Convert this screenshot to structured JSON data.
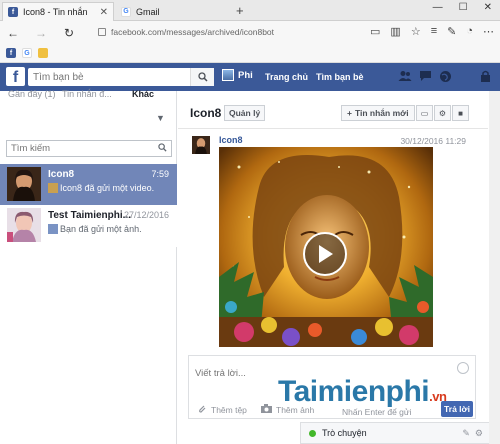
{
  "browser": {
    "tabs": [
      {
        "title": "Icon8 - Tin nhắn",
        "active": true
      },
      {
        "title": "Gmail",
        "active": false
      }
    ],
    "new_tab": "+",
    "window_buttons": [
      "—",
      "☐",
      "✕"
    ],
    "address": "facebook.com/messages/archived/icon8bot",
    "nav": {
      "back": "←",
      "forward": "→",
      "reload": "↻"
    }
  },
  "facebook": {
    "search_placeholder": "Tìm bạn bè",
    "profile_name": "Phi",
    "links": [
      "Trang chủ",
      "Tìm bạn bè"
    ],
    "brand_color": "#3b5998"
  },
  "sidebar": {
    "filters": [
      "Gần đây (1)",
      "Tin nhắn đ...",
      "Khác"
    ],
    "search_placeholder": "Tìm kiếm",
    "conversations": [
      {
        "name": "Icon8",
        "time": "7:59",
        "preview": "Icon8 đã gửi một video.",
        "selected": true
      },
      {
        "name": "Test Taimienphi...",
        "time": "27/12/2016",
        "preview": "Bạn đã gửi một ảnh.",
        "selected": false
      }
    ],
    "selected_color": "#7186b8"
  },
  "thread": {
    "name": "Icon8",
    "manage_label": "Quản lý",
    "new_message_label": "Tin nhắn mới",
    "message": {
      "sender": "Icon8",
      "date": "30/12/2016 11:29"
    },
    "composer": {
      "placeholder": "Viết trả lời...",
      "add_files": "Thêm tệp",
      "add_photos": "Thêm ảnh",
      "enter_send": "Nhấn Enter để gửi",
      "reply_label": "Trả lời"
    }
  },
  "chat": {
    "label": "Trò chuyện"
  },
  "watermark": {
    "text": "Taimienphi",
    "suffix": ".vn"
  }
}
